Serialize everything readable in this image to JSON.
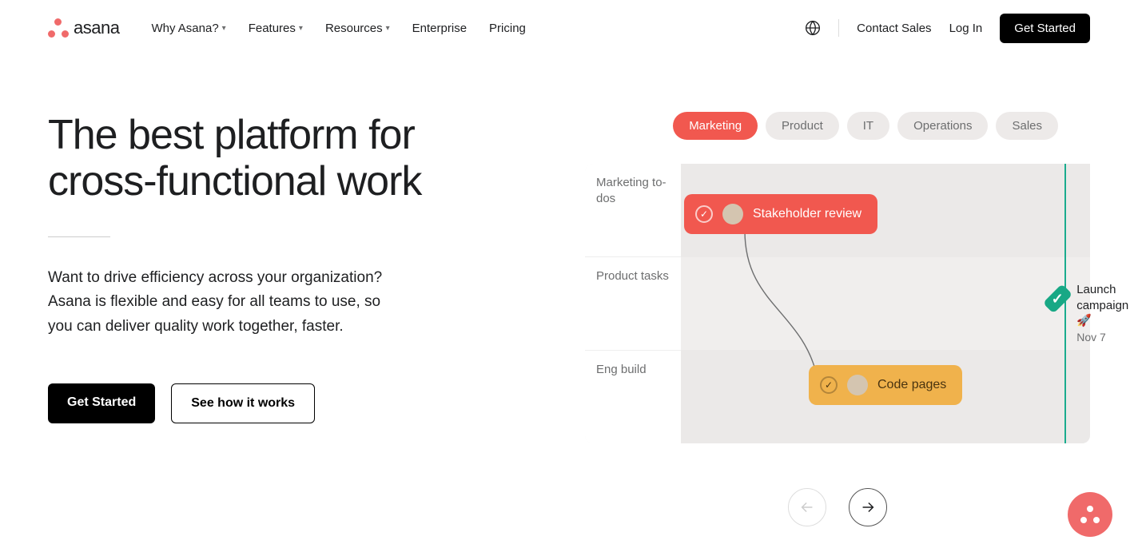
{
  "brand": {
    "name": "asana"
  },
  "nav": {
    "items": [
      {
        "label": "Why Asana?",
        "has_chevron": true
      },
      {
        "label": "Features",
        "has_chevron": true
      },
      {
        "label": "Resources",
        "has_chevron": true
      },
      {
        "label": "Enterprise",
        "has_chevron": false
      },
      {
        "label": "Pricing",
        "has_chevron": false
      }
    ],
    "contact": "Contact Sales",
    "login": "Log In",
    "cta": "Get Started"
  },
  "hero": {
    "title": "The best platform for cross-functional work",
    "description": "Want to drive efficiency across your organization? Asana is flexible and easy for all teams to use, so you can deliver quality work together, faster.",
    "primary_cta": "Get Started",
    "secondary_cta": "See how it works"
  },
  "tabs": [
    "Marketing",
    "Product",
    "IT",
    "Operations",
    "Sales"
  ],
  "tabs_active": 0,
  "timeline": {
    "sections": [
      "Marketing to-dos",
      "Product tasks",
      "Eng build"
    ],
    "cards": {
      "stakeholder": "Stakeholder review",
      "code": "Code pages"
    },
    "milestone": {
      "title": "Launch campaign 🚀",
      "date": "Nov 7"
    }
  }
}
